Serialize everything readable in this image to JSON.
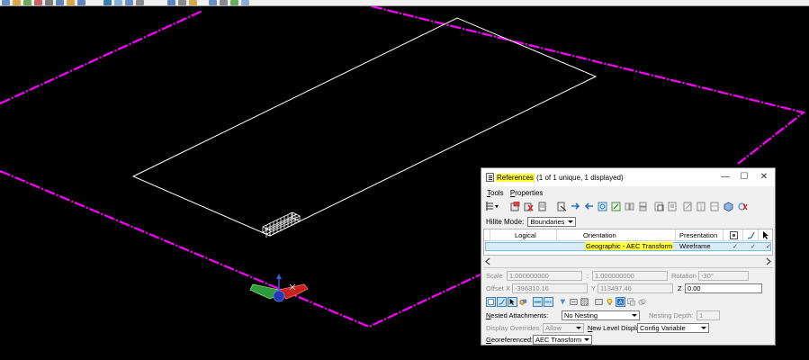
{
  "colors": {
    "viewport_background": "#000000",
    "boundary_magenta": "#ff00ff",
    "element_outline": "#ffffff",
    "highlight_yellow": "#ffff3a",
    "selection_blue": "#d9ebf9"
  },
  "dialog": {
    "title_main": "References",
    "title_suffix": " (1 of 1 unique, 1 displayed)",
    "title_icon": "references-icon",
    "minimize_glyph": "—",
    "maximize_glyph": "☐",
    "close_glyph": "✕",
    "menu": [
      {
        "pre": "",
        "u": "T",
        "post": "ools"
      },
      {
        "pre": "",
        "u": "P",
        "post": "roperties"
      }
    ],
    "hilite_mode": {
      "label": "Hilite Mode:",
      "value": "Boundaries"
    },
    "table": {
      "columns": [
        "Logical",
        "Orientation",
        "Presentation"
      ],
      "rows": [
        {
          "logical": "",
          "orientation": "Geographic - AEC Transform",
          "presentation": "Wireframe",
          "checks": [
            "✓",
            "✓",
            "✓"
          ]
        }
      ]
    },
    "scale": {
      "label": "Scale",
      "value1": "1.000000000",
      "separator": ":",
      "value2": "1.000000000"
    },
    "rotation": {
      "label": "Rotation",
      "value": "-30°"
    },
    "offset_x": {
      "label": "Offset X",
      "value": "-396310.16"
    },
    "offset_y": {
      "label": "Y",
      "value": "113497.46"
    },
    "offset_z": {
      "label": "Z",
      "value": "0.00"
    },
    "nested_attachments": {
      "pre": "",
      "u": "N",
      "post": "ested Attachments:",
      "value": "No Nesting"
    },
    "nesting_depth": {
      "label": "Nesting Depth:",
      "value": "1"
    },
    "display_overrides": {
      "label": "Display Overrides:",
      "value": "Allow"
    },
    "new_level_display": {
      "pre": "",
      "u": "N",
      "post": "ew Level Display:",
      "value": "Config Variable"
    },
    "georeferenced": {
      "pre": "",
      "u": "G",
      "post": "eoreferenced:",
      "value": "AEC Transform"
    }
  }
}
